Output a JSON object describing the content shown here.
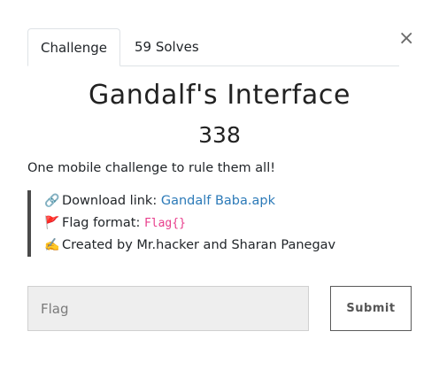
{
  "tabs": {
    "challenge": "Challenge",
    "solves": "59 Solves"
  },
  "close_glyph": "×",
  "challenge": {
    "name": "Gandalf's Interface",
    "points": "338",
    "description": "One mobile challenge to rule them all!"
  },
  "details": {
    "download": {
      "icon": "link-icon",
      "glyph": "🔗",
      "label": "Download link: ",
      "link_text": "Gandalf Baba.apk"
    },
    "flag_format": {
      "icon": "red-flag-icon",
      "glyph": "🚩",
      "label": "Flag format: ",
      "code": "Flag{}"
    },
    "author": {
      "icon": "writing-hand-icon",
      "glyph": "✍️",
      "text": "Created by Mr.hacker and Sharan Panegav"
    }
  },
  "form": {
    "flag_placeholder": "Flag",
    "submit_label": "Submit"
  },
  "colors": {
    "link": "#2c7ab8",
    "code": "#e83e8c",
    "quote_border": "#4a4a4a",
    "input_bg": "#eeeeee"
  }
}
